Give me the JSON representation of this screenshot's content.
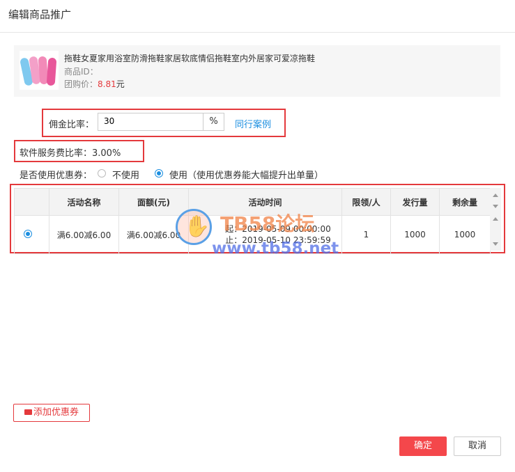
{
  "dialog": {
    "title": "编辑商品推广"
  },
  "product": {
    "name": "拖鞋女夏家用浴室防滑拖鞋家居软底情侣拖鞋室内外居家可爱凉拖鞋",
    "id_label": "商品ID：",
    "price_label": "团购价：",
    "price_value": "8.81",
    "price_unit": "元"
  },
  "commission": {
    "label": "佣金比率：",
    "value": "30",
    "unit": "%",
    "link": "同行案例"
  },
  "service_fee": {
    "label": "软件服务费比率：3.00%"
  },
  "coupon_use": {
    "question": "是否使用优惠券：",
    "option_no": "不使用",
    "option_yes": "使用（使用优惠券能大幅提升出单量）",
    "selected": "yes"
  },
  "coupon_table": {
    "headers": [
      "",
      "活动名称",
      "面额(元)",
      "活动时间",
      "限领/人",
      "发行量",
      "剩余量"
    ],
    "rows": [
      {
        "name": "满6.00减6.00",
        "amount": "满6.00减6.00",
        "start": "起：2019-05-09 00:00:00",
        "end": "止：2019-05-10 23:59:59",
        "limit": "1",
        "issued": "1000",
        "remaining": "1000"
      }
    ]
  },
  "watermark": {
    "line1": "TB58论坛",
    "line2": "www.tb58.net"
  },
  "footer": {
    "add_coupon": "添加优惠券",
    "confirm": "确定",
    "cancel": "取消"
  },
  "colors": {
    "accent_red": "#e4393c",
    "link_blue": "#1a8ee0",
    "confirm_bg": "#f4474b"
  }
}
